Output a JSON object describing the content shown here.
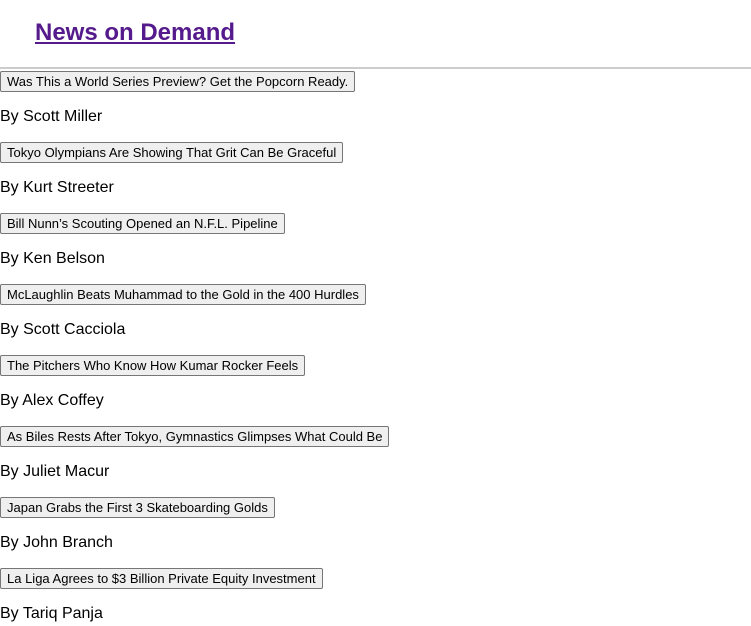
{
  "header": {
    "title": "News on Demand"
  },
  "articles": [
    {
      "headline": "Was This a World Series Preview? Get the Popcorn Ready.",
      "byline": "By Scott Miller"
    },
    {
      "headline": "Tokyo Olympians Are Showing That Grit Can Be Graceful",
      "byline": "By Kurt Streeter"
    },
    {
      "headline": "Bill Nunn’s Scouting Opened an N.F.L. Pipeline",
      "byline": "By Ken Belson"
    },
    {
      "headline": "McLaughlin Beats Muhammad to the Gold in the 400 Hurdles",
      "byline": "By Scott Cacciola"
    },
    {
      "headline": "The Pitchers Who Know How Kumar Rocker Feels",
      "byline": "By Alex Coffey"
    },
    {
      "headline": "As Biles Rests After Tokyo, Gymnastics Glimpses What Could Be",
      "byline": "By Juliet Macur"
    },
    {
      "headline": "Japan Grabs the First 3 Skateboarding Golds",
      "byline": "By John Branch"
    },
    {
      "headline": "La Liga Agrees to $3 Billion Private Equity Investment",
      "byline": "By Tariq Panja"
    }
  ]
}
